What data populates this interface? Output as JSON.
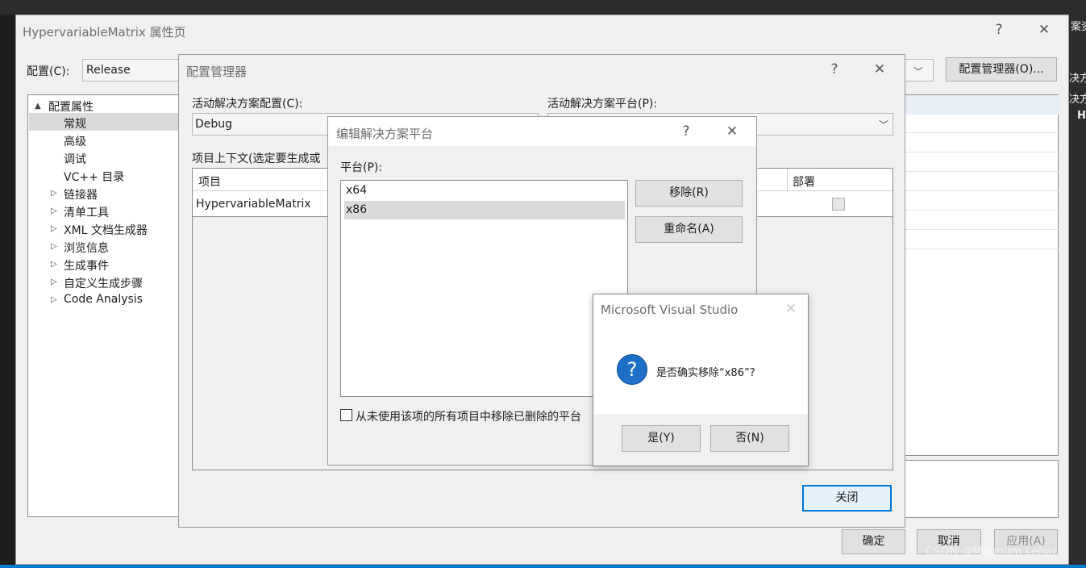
{
  "props": {
    "title": "HypervariableMatrix 属性页",
    "help": "?",
    "close": "✕",
    "config_label": "配置(C):",
    "config_value": "Release",
    "config_manager_btn": "配置管理器(O)...",
    "tree": [
      {
        "label": "配置属性",
        "toggle": "▲",
        "expanded": true
      },
      {
        "label": "常规",
        "selected": true
      },
      {
        "label": "高级"
      },
      {
        "label": "调试"
      },
      {
        "label": "VC++ 目录"
      },
      {
        "label": "链接器",
        "toggle": "▷"
      },
      {
        "label": "清单工具",
        "toggle": "▷"
      },
      {
        "label": "XML 文档生成器",
        "toggle": "▷"
      },
      {
        "label": "浏览信息",
        "toggle": "▷"
      },
      {
        "label": "生成事件",
        "toggle": "▷"
      },
      {
        "label": "自定义生成步骤",
        "toggle": "▷"
      },
      {
        "label": "Code Analysis",
        "toggle": "▷"
      }
    ],
    "ok": "确定",
    "cancel": "取消",
    "apply": "应用(A)"
  },
  "config_manager": {
    "title": "配置管理器",
    "help": "?",
    "close": "✕",
    "active_config_label": "活动解决方案配置(C):",
    "active_config_value": "Debug",
    "active_platform_label": "活动解决方案平台(P):",
    "contexts_label": "项目上下文(选定要生成或",
    "col_project": "项目",
    "col_deploy": "部署",
    "row_project": "HypervariableMatrix",
    "close_btn": "关闭"
  },
  "edit_platforms": {
    "title": "编辑解决方案平台",
    "help": "?",
    "close": "✕",
    "platform_label": "平台(P):",
    "platforms": [
      "x64",
      "x86"
    ],
    "selected_platform": "x86",
    "remove_btn": "移除(R)",
    "rename_btn": "重命名(A)",
    "checkbox_label": "从未使用该项的所有项目中移除已删除的平台"
  },
  "confirm": {
    "title": "Microsoft Visual Studio",
    "close": "✕",
    "message": "是否确实移除“x86”?",
    "yes": "是(Y)",
    "no": "否(N)"
  },
  "background": {
    "right_texts": [
      "案资",
      "决方",
      "决方",
      "H"
    ]
  },
  "watermark": "CSDN @Magnum Lehar",
  "colors": {
    "accent": "#0078d7",
    "selection": "#dadada",
    "editor_bg": "#2d2d30"
  }
}
